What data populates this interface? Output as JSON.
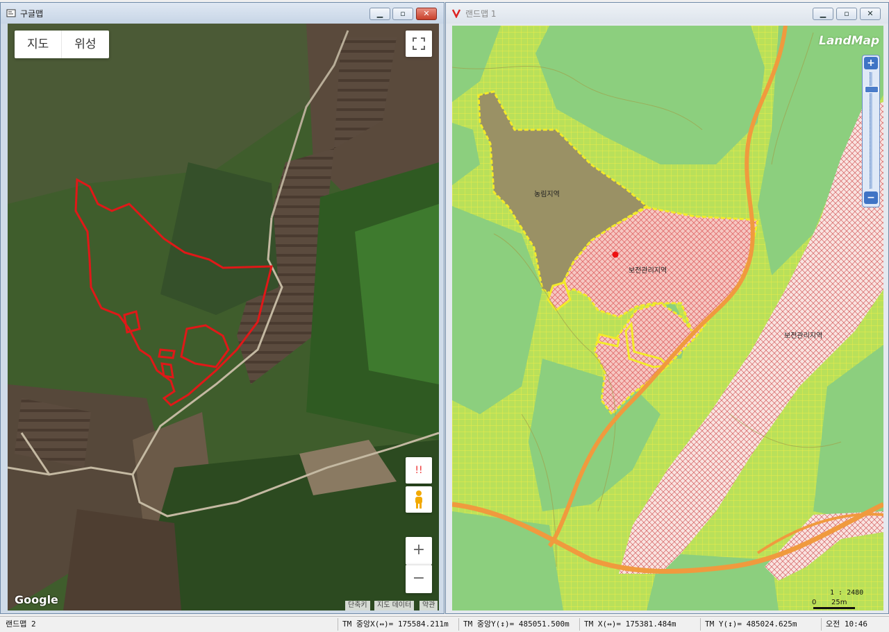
{
  "google_window": {
    "title": "구글맵",
    "map_type": {
      "map": "지도",
      "satellite": "위성"
    },
    "fullscreen_icon": "fullscreen-icon",
    "alert_label": "!!",
    "zoom_in": "+",
    "zoom_out": "−",
    "logo": "Google",
    "footer": {
      "shortcuts": "단축키",
      "map_data": "지도 데이터",
      "terms": "약관"
    }
  },
  "landmap_window": {
    "title": "랜드맵 1",
    "brand": "LandMap",
    "zone_labels": {
      "farmland": "농림지역",
      "conservation_1": "보전관리지역",
      "conservation_2": "보전관리지역"
    },
    "scale": {
      "ratio": "1 : 2480",
      "zero": "0",
      "distance": "25m"
    },
    "colors": {
      "green_zone": "#8ccf7e",
      "grid_zone": "#b9e05a",
      "conservation": "#f4b8b8",
      "farmland": "#9a9165",
      "boundary": "#f3ea2a",
      "road": "#f09a3e"
    }
  },
  "status_bar": {
    "window": "랜드맵 2",
    "tm_center_x": "TM 중앙X(↔)= 175584.211m",
    "tm_center_y": "TM 중앙Y(↕)= 485051.500m",
    "tm_x": "TM X(↔)= 175381.484m",
    "tm_y": "TM Y(↕)= 485024.625m",
    "time": "오전 10:46"
  }
}
